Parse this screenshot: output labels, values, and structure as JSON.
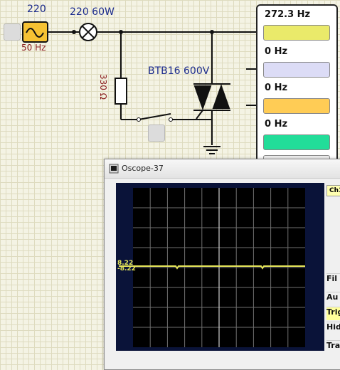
{
  "source": {
    "value_label": "220",
    "freq_label": "50 Hz"
  },
  "lamp": {
    "label": "220 60W"
  },
  "resistor": {
    "label": "330 Ω"
  },
  "triac": {
    "label": "BTB16 600V"
  },
  "meter": {
    "readings": [
      {
        "value": "272.3 Hz",
        "color": "#eaea6a"
      },
      {
        "value": "0 Hz",
        "color": "#dcdcf6"
      },
      {
        "value": "0 Hz",
        "color": "#ffcc55"
      },
      {
        "value": "0 Hz",
        "color": "#22dd99"
      }
    ]
  },
  "oscope": {
    "title": "Oscope-37",
    "channel_tab": "Ch1",
    "level_top": "8.22",
    "level_bottom": "-8.22",
    "trace_color": "#e6e65a",
    "side_items": [
      "Fil",
      "Au",
      "Trig",
      "Hid",
      "Tra"
    ]
  }
}
